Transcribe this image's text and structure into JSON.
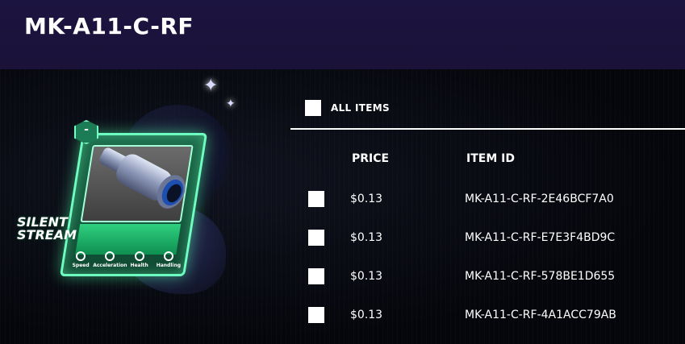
{
  "header": {
    "title": "MK-A11-C-RF"
  },
  "card": {
    "badge": "-",
    "name_line1": "SILENT",
    "name_line2": "STREAM",
    "stats": [
      "Speed",
      "Acceleration",
      "Health",
      "Handling"
    ]
  },
  "list": {
    "select_all_label": "ALL ITEMS",
    "columns": {
      "price": "PRICE",
      "item_id": "ITEM ID"
    },
    "rows": [
      {
        "price": "$0.13",
        "item_id": "MK-A11-C-RF-2E46BCF7A0"
      },
      {
        "price": "$0.13",
        "item_id": "MK-A11-C-RF-E7E3F4BD9C"
      },
      {
        "price": "$0.13",
        "item_id": "MK-A11-C-RF-578BE1D655"
      },
      {
        "price": "$0.13",
        "item_id": "MK-A11-C-RF-4A1ACC79AB"
      }
    ]
  },
  "colors": {
    "header_bg": "#1c1440",
    "card_glow": "#6dffc0",
    "card_title": "#2fd07f"
  }
}
